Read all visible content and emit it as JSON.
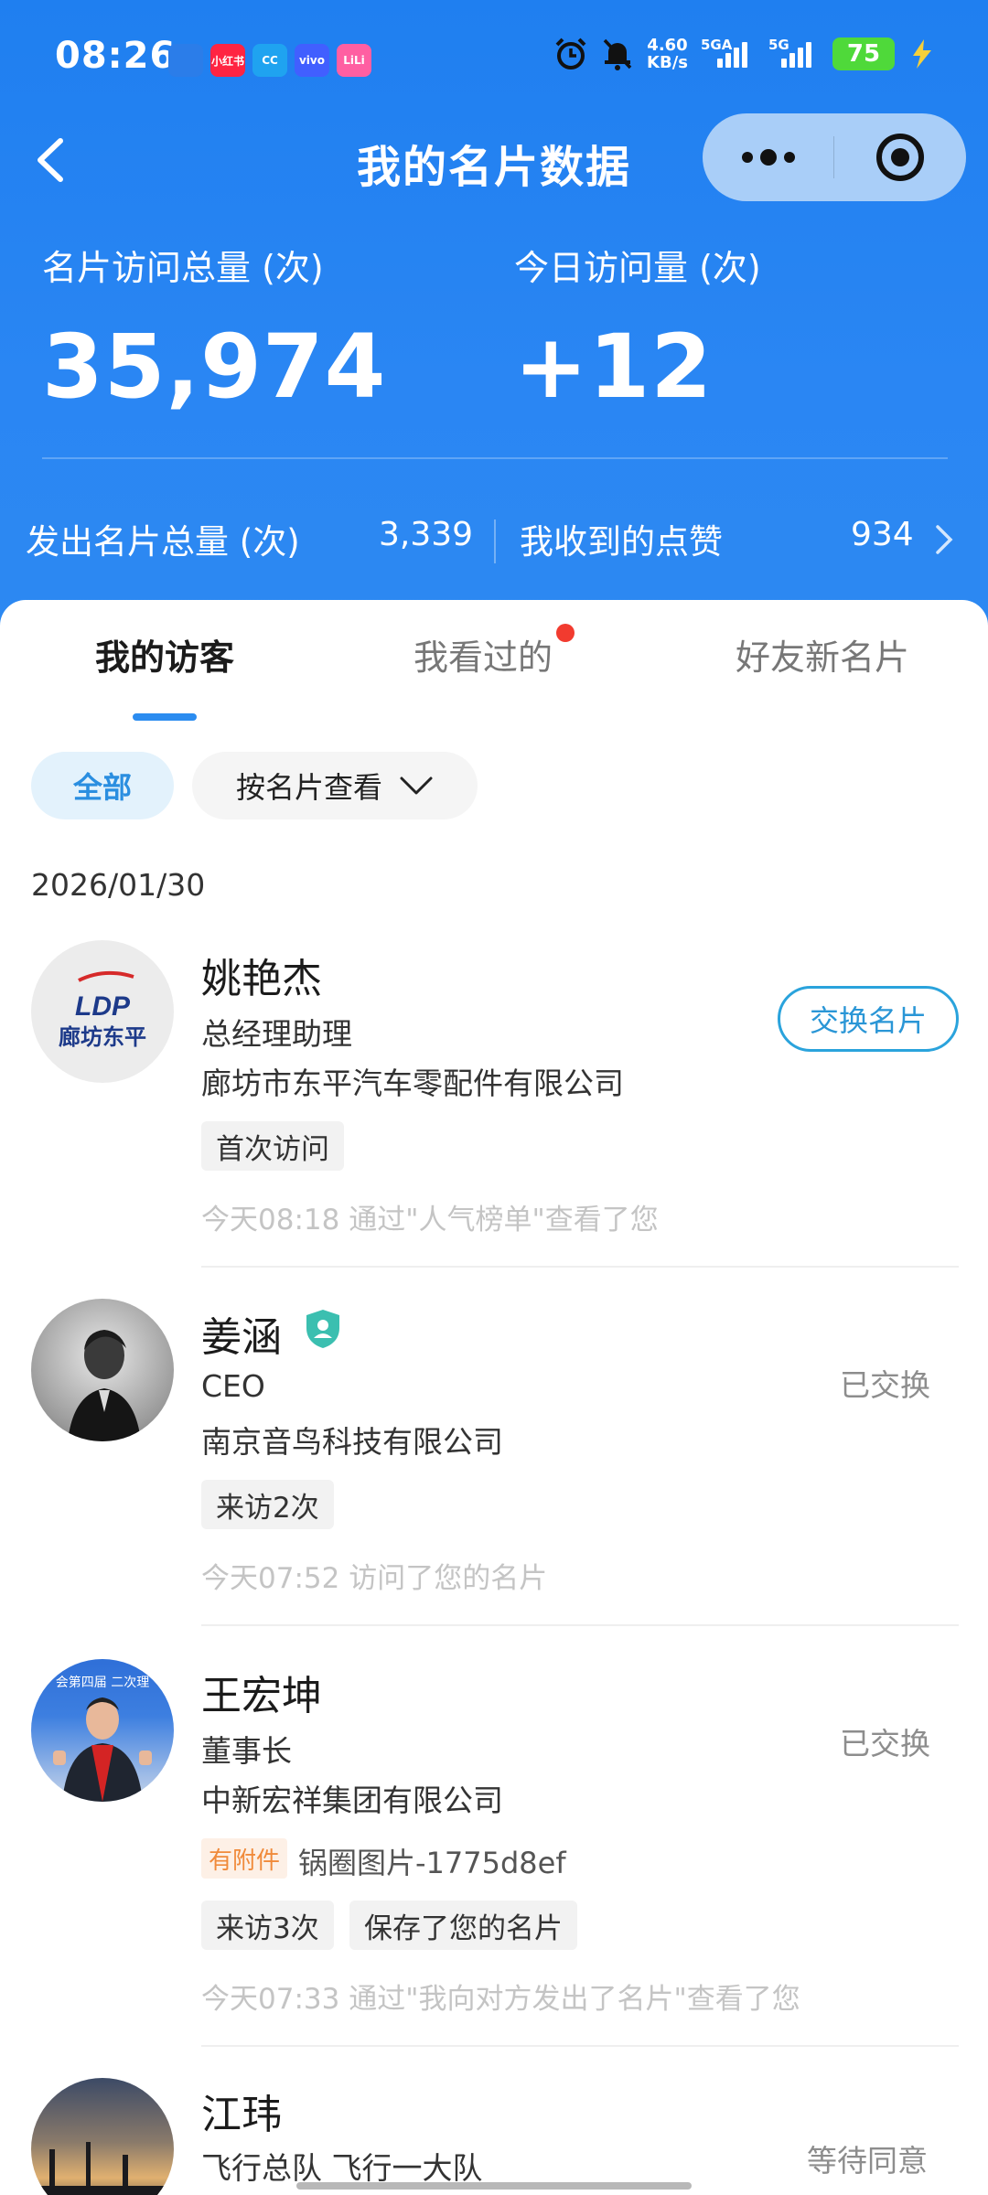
{
  "status_bar": {
    "time": "08:26",
    "apps": [
      {
        "name": "app-icon-1",
        "text": "",
        "color": "#2b7de9"
      },
      {
        "name": "xiaohongshu-icon",
        "text": "小红书",
        "color": "#ff2442"
      },
      {
        "name": "app-icon-cc",
        "text": "CC",
        "color": "#1fa3f0"
      },
      {
        "name": "vivo-icon",
        "text": "vivo",
        "color": "#415fff"
      },
      {
        "name": "app-icon-pink",
        "text": "LiLi",
        "color": "#ff5fa2"
      }
    ],
    "net_speed_value": "4.60",
    "net_speed_unit": "KB/s",
    "signal1_label": "5GA",
    "signal2_label": "5G",
    "battery": "75"
  },
  "nav": {
    "title": "我的名片数据"
  },
  "stats": {
    "total_visits_label": "名片访问总量 (次)",
    "total_visits_value": "35,974",
    "today_visits_label": "今日访问量 (次)",
    "today_visits_value": "+12",
    "sent_label": "发出名片总量 (次)",
    "sent_value": "3,339",
    "likes_label": "我收到的点赞",
    "likes_value": "934"
  },
  "tabs": [
    {
      "label": "我的访客",
      "active": true
    },
    {
      "label": "我看过的",
      "active": false,
      "dot": true
    },
    {
      "label": "好友新名片",
      "active": false
    }
  ],
  "filters": {
    "all": "全部",
    "by_card": "按名片查看"
  },
  "date": "2026/01/30",
  "visitors": [
    {
      "name": "姚艳杰",
      "title": "总经理助理",
      "company": "廊坊市东平汽车零配件有限公司",
      "avatar_logo_top": "LDP",
      "avatar_logo_bottom": "廊坊东平",
      "tags": [
        "首次访问"
      ],
      "note": "今天08:18 通过\"人气榜单\"查看了您",
      "action": "交换名片"
    },
    {
      "name": "姜涵",
      "title": "CEO",
      "company": "南京音鸟科技有限公司",
      "tags": [
        "来访2次"
      ],
      "note": "今天07:52 访问了您的名片",
      "status": "已交换"
    },
    {
      "name": "王宏坤",
      "title": "董事长",
      "company": "中新宏祥集团有限公司",
      "avatar_banner_text": "会第四届 二次理",
      "attachment_label": "有附件",
      "attachment_name": "锅圈图片-1775d8ef",
      "tags": [
        "来访3次",
        "保存了您的名片"
      ],
      "note": "今天07:33 通过\"我向对方发出了名片\"查看了您",
      "status": "已交换"
    },
    {
      "name": "江玮",
      "title": "飞行总队 飞行一大队",
      "status": "等待同意"
    }
  ]
}
